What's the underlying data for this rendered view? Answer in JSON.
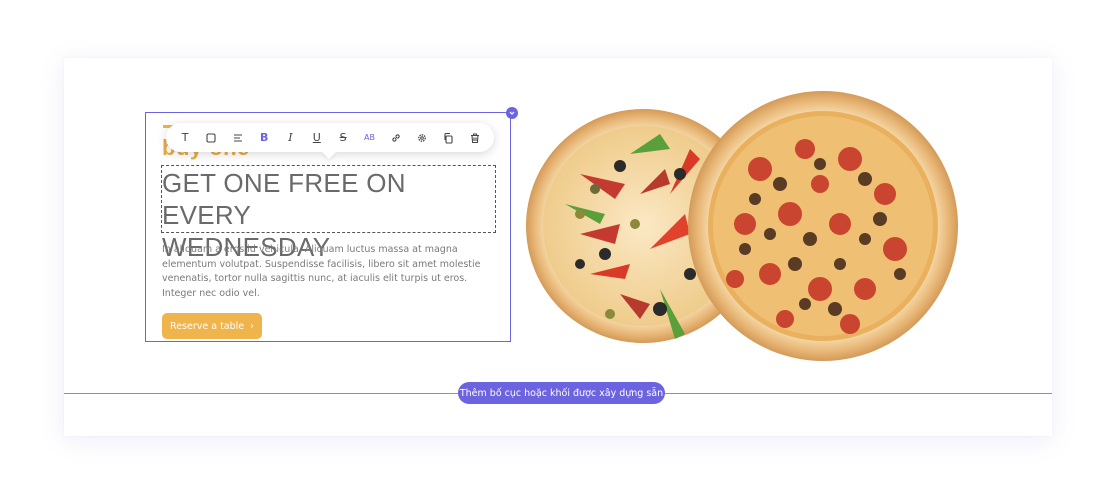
{
  "toolbar": {
    "items": [
      {
        "name": "text-type-icon",
        "glyph": "T"
      },
      {
        "name": "box-icon",
        "glyph": ""
      },
      {
        "name": "align-icon",
        "glyph": ""
      },
      {
        "name": "bold-icon",
        "glyph": "B"
      },
      {
        "name": "italic-icon",
        "glyph": "I"
      },
      {
        "name": "underline-icon",
        "glyph": "U"
      },
      {
        "name": "strikethrough-icon",
        "glyph": "S"
      },
      {
        "name": "text-color-icon",
        "glyph": "AB"
      },
      {
        "name": "link-icon",
        "glyph": ""
      },
      {
        "name": "settings-icon",
        "glyph": ""
      },
      {
        "name": "duplicate-icon",
        "glyph": ""
      },
      {
        "name": "delete-icon",
        "glyph": ""
      }
    ]
  },
  "content": {
    "eyebrow": "buy one",
    "heading_line1": "GET ONE FREE ON EVERY",
    "heading_line2": "WEDNESDAY",
    "body": "In aliquam a eros id vehicula. Aliquam luctus massa at magna elementum volutpat. Suspendisse facilisis, libero sit amet molestie venenatis, tortor nulla sagittis nunc, at iaculis elit turpis ut eros. Integer nec odio vel.",
    "button_label": "Reserve a table",
    "button_chevron": "›"
  },
  "builder": {
    "add_layout_label": "Thêm bố cục hoặc khối được xây dựng sẵn"
  },
  "colors": {
    "accent": "#6c63e0",
    "brand_yellow": "#f0b44c",
    "heading_gray": "#6a6a6a"
  }
}
